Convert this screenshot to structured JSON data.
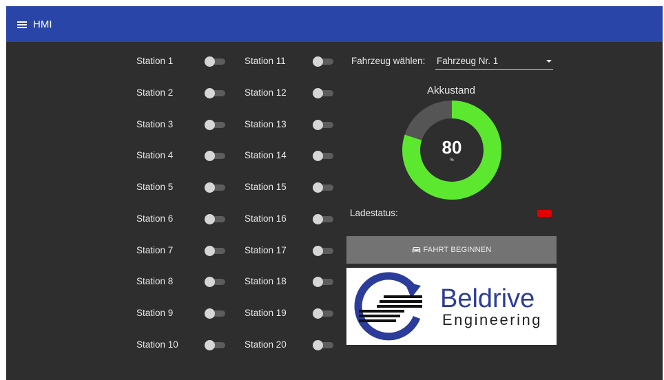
{
  "app": {
    "title": "HMI",
    "bar_color": "#2a45a8",
    "background_color": "#2e2e2e"
  },
  "stations_left": [
    {
      "label": "Station 1",
      "on": false
    },
    {
      "label": "Station 2",
      "on": false
    },
    {
      "label": "Station 3",
      "on": false
    },
    {
      "label": "Station 4",
      "on": false
    },
    {
      "label": "Station 5",
      "on": false
    },
    {
      "label": "Station 6",
      "on": false
    },
    {
      "label": "Station 7",
      "on": false
    },
    {
      "label": "Station 8",
      "on": false
    },
    {
      "label": "Station 9",
      "on": false
    },
    {
      "label": "Station 10",
      "on": false
    }
  ],
  "stations_right": [
    {
      "label": "Station 11",
      "on": false
    },
    {
      "label": "Station 12",
      "on": false
    },
    {
      "label": "Station 13",
      "on": false
    },
    {
      "label": "Station 14",
      "on": false
    },
    {
      "label": "Station 15",
      "on": false
    },
    {
      "label": "Station 16",
      "on": false
    },
    {
      "label": "Station 17",
      "on": false
    },
    {
      "label": "Station 18",
      "on": false
    },
    {
      "label": "Station 19",
      "on": false
    },
    {
      "label": "Station 20",
      "on": false
    }
  ],
  "vehicle": {
    "label": "Fahrzeug wählen:",
    "selected": "Fahrzeug Nr. 1"
  },
  "battery": {
    "title": "Akkustand",
    "value": 80,
    "value_text": "80",
    "unit": "%",
    "fill_color": "#5ce82e",
    "track_color": "#555555"
  },
  "charging": {
    "label": "Ladestatus:",
    "indicator_color": "#e00000"
  },
  "start_button": {
    "label": "FAHRT BEGINNEN",
    "icon": "car-icon"
  },
  "logo": {
    "word1": "Beldrive",
    "word2": "Engineering",
    "ring_color": "#2b3c9a"
  }
}
